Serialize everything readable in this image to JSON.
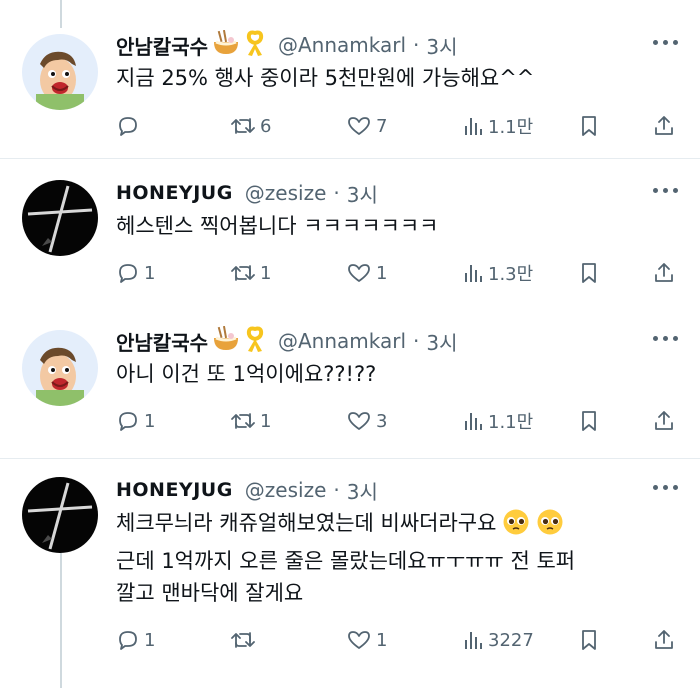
{
  "tweets": [
    {
      "author": "안남칼국수",
      "handle": "@Annamkarl",
      "time": "3시",
      "lines": [
        "지금 25% 행사 중이라 5천만원에 가능해요^^"
      ],
      "replies": "",
      "retweets": "6",
      "likes": "7",
      "views": "1.1만"
    },
    {
      "author": "HONEYJUG",
      "handle": "@zesize",
      "time": "3시",
      "lines": [
        "헤스텐스 찍어봅니다 ㅋㅋㅋㅋㅋㅋㅋ"
      ],
      "replies": "1",
      "retweets": "1",
      "likes": "1",
      "views": "1.3만"
    },
    {
      "author": "안남칼국수",
      "handle": "@Annamkarl",
      "time": "3시",
      "lines": [
        "아니 이건 또 1억이에요??!??"
      ],
      "replies": "1",
      "retweets": "1",
      "likes": "3",
      "views": "1.1만"
    },
    {
      "author": "HONEYJUG",
      "handle": "@zesize",
      "time": "3시",
      "lines": [
        "체크무늬라 캐쥬얼해보였는데 비싸더라구요",
        "근데 1억까지 오른 줄은 몰랐는데요ㅠㅜㅠㅠ 전 토퍼",
        "깔고 맨바닥에 잘게요"
      ],
      "replies": "1",
      "retweets": "",
      "likes": "1",
      "views": "3227"
    }
  ],
  "separator": "·",
  "icons": {
    "reply": "reply-icon",
    "retweet": "retweet-icon",
    "like": "heart-icon",
    "views": "views-chart-icon",
    "bookmark": "bookmark-icon",
    "share": "share-icon",
    "more": "more-dots-icon",
    "ramen": "ramen-emoji-icon",
    "ribbon": "yellow-ribbon-emoji-icon",
    "pleading": "pleading-face-emoji-icon"
  },
  "colors": {
    "text": "#0f1419",
    "secondary": "#536471",
    "ribbon": "#f7c51e",
    "divider": "#e6ecf0"
  }
}
